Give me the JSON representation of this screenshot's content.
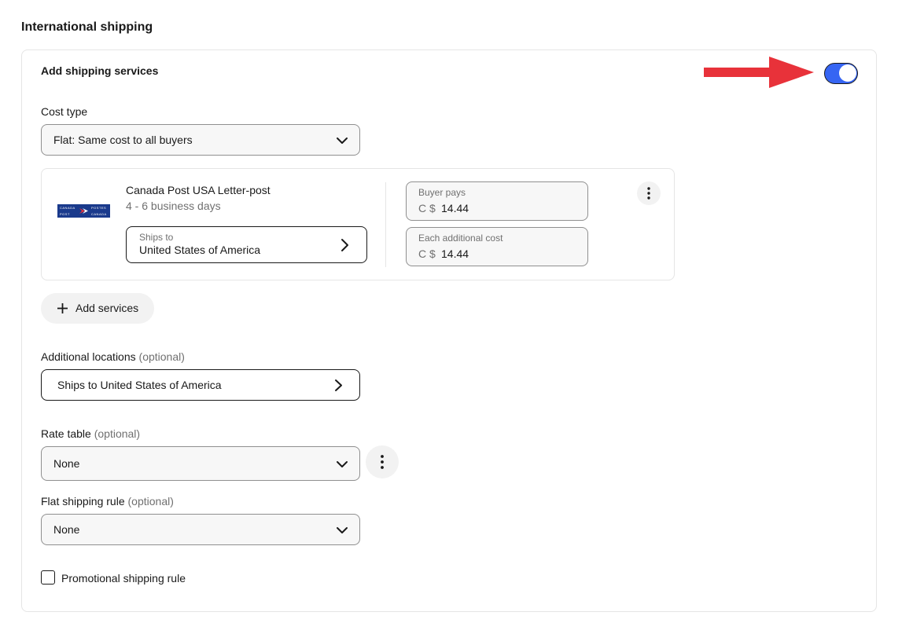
{
  "section": {
    "title": "International shipping"
  },
  "card": {
    "title": "Add shipping services",
    "toggle_on": true,
    "toggle_color": "#3665f3",
    "arrow_color": "#e8323a"
  },
  "cost_type": {
    "label": "Cost type",
    "value": "Flat: Same cost to all buyers"
  },
  "service": {
    "logo": {
      "line1_left": "CANADA",
      "line1_right": "POSTES",
      "line2_left": "POST",
      "line2_right": "CANADA"
    },
    "name": "Canada Post USA Letter-post",
    "days": "4 - 6 business days",
    "ships_to_caption": "Ships to",
    "ships_to_value": "United States of America",
    "buyer_pays": {
      "caption": "Buyer pays",
      "currency": "C $",
      "amount": "14.44"
    },
    "additional_cost": {
      "caption": "Each additional cost",
      "currency": "C $",
      "amount": "14.44"
    }
  },
  "add_services": {
    "label": "Add services"
  },
  "additional_locations": {
    "label": "Additional locations",
    "optional": "(optional)",
    "value": "Ships to United States of America"
  },
  "rate_table": {
    "label": "Rate table",
    "optional": "(optional)",
    "value": "None"
  },
  "flat_rule": {
    "label": "Flat shipping rule",
    "optional": "(optional)",
    "value": "None"
  },
  "promo_rule": {
    "label": "Promotional shipping rule",
    "checked": false
  }
}
